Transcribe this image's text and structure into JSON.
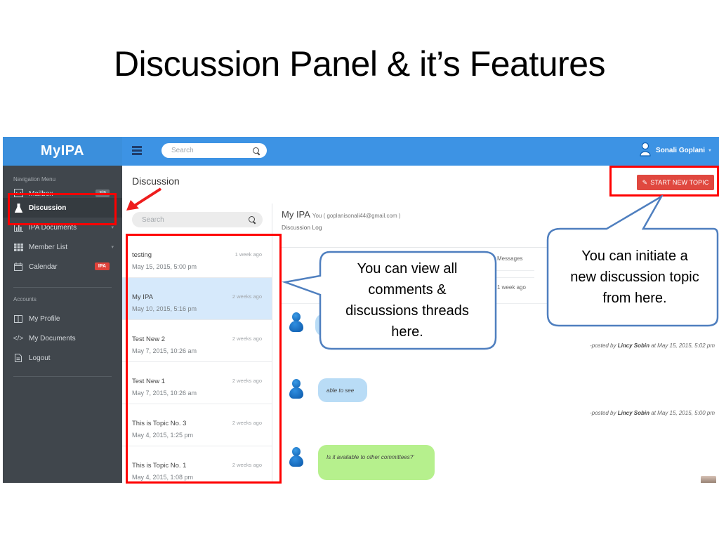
{
  "slide": {
    "title": "Discussion Panel & it’s Features"
  },
  "app": {
    "brand": "MyIPA",
    "topbar": {
      "search_placeholder": "Search",
      "user_name": "Sonali Goplani"
    },
    "sidebar": {
      "nav_heading": "Navigation Menu",
      "items": [
        {
          "label": "Mailbox",
          "icon": "mailbox-icon",
          "badge": "3/5"
        },
        {
          "label": "Discussion",
          "icon": "flask-icon",
          "active": true
        },
        {
          "label": "IPA Documents",
          "icon": "bar-chart-icon",
          "caret": true
        },
        {
          "label": "Member List",
          "icon": "grid-icon",
          "caret": true
        },
        {
          "label": "Calendar",
          "icon": "calendar-icon",
          "badge": "IPA"
        }
      ],
      "accounts_heading": "Accounts",
      "accounts": [
        {
          "label": "My Profile",
          "icon": "columns-icon"
        },
        {
          "label": "My Documents",
          "icon": "code-icon"
        },
        {
          "label": "Logout",
          "icon": "document-icon"
        }
      ]
    },
    "discussion": {
      "heading": "Discussion",
      "start_button": "START NEW TOPIC",
      "topic_search_placeholder": "Search",
      "topics": [
        {
          "title": "testing",
          "date": "May 15, 2015, 5:00 pm",
          "ago": "1 week ago"
        },
        {
          "title": "My IPA",
          "date": "May 10, 2015, 5:16 pm",
          "ago": "2 weeks ago",
          "selected": true
        },
        {
          "title": "Test New 2",
          "date": "May 7, 2015, 10:26 am",
          "ago": "2 weeks ago"
        },
        {
          "title": "Test New 1",
          "date": "May 7, 2015, 10:26 am",
          "ago": "2 weeks ago"
        },
        {
          "title": "This is Topic No. 3",
          "date": "May 4, 2015, 1:25 pm",
          "ago": "2 weeks ago"
        },
        {
          "title": "This is Topic No. 1",
          "date": "May 4, 2015, 1:08 pm",
          "ago": "2 weeks ago"
        }
      ],
      "thread": {
        "title": "My IPA",
        "owner": "You ( goplanisonali44@gmail.com )",
        "subtitle": "Discussion Log",
        "messages_label": "Messages",
        "messages_ago": "1 week ago",
        "comments": [
          {
            "text": "",
            "posted_prefix": "-posted by",
            "author": "Lincy Sobin",
            "at": "at May 15, 2015, 5:02 pm",
            "color": "blue"
          },
          {
            "text": "able to see",
            "posted_prefix": "-posted by",
            "author": "Lincy Sobin",
            "at": "at May 15, 2015, 5:00 pm",
            "color": "blue"
          },
          {
            "text": "Is it available to other committees?'",
            "color": "green"
          }
        ]
      }
    }
  },
  "annotations": {
    "callout_threads": "You can view  all comments  & discussions threads here.",
    "callout_threads_lines": [
      "You can view  all",
      "comments  &",
      "discussions threads",
      "here."
    ],
    "callout_new_topic_lines": [
      "You can initiate a",
      "new discussion topic",
      "from here."
    ],
    "highlight_color": "#ff0000",
    "callout_border_color": "#4f7fbf"
  },
  "colors": {
    "brand_blue": "#3b8fdc",
    "sidebar_bg": "#40464c",
    "start_button": "#e0483f",
    "selected_topic": "#d6e9fb",
    "bubble_blue": "#b9dcf6",
    "bubble_green": "#b6f08d"
  }
}
